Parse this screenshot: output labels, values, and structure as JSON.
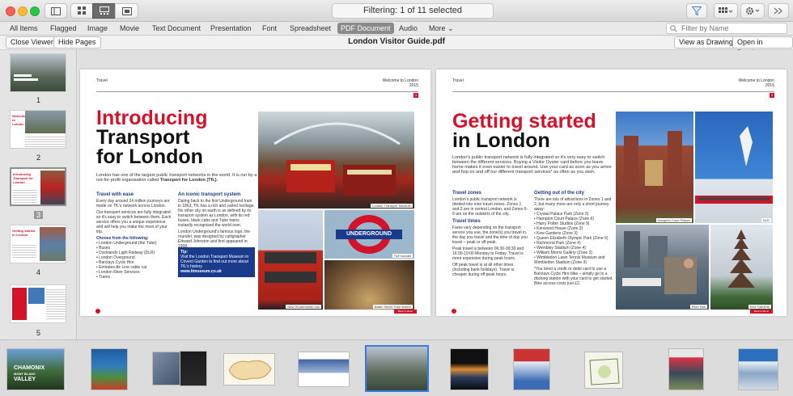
{
  "toolbar": {
    "status": "Filtering: 1 of 11 selected"
  },
  "filters": [
    "All Items",
    "Flagged",
    "Image",
    "Movie",
    "Text Document",
    "Presentation",
    "Font",
    "Spreadsheet",
    "PDF Document",
    "Audio",
    "More"
  ],
  "search": {
    "placeholder": "Filter by Name"
  },
  "viewer": {
    "close_label": "Close Viewer",
    "hide_pages_label": "Hide Pages",
    "title": "London Visitor Guide.pdf",
    "drawing_label": "View as Drawing",
    "preview_label": "Open in Preview"
  },
  "sidebar": {
    "pages": [
      "1",
      "2",
      "3",
      "4",
      "5"
    ],
    "thumb2_title": "Welcome to London",
    "thumb3_title": "Introducing Transport for London",
    "thumb4_title": "Getting started in London"
  },
  "left_page": {
    "section": "Travel",
    "header_right": "Welcome to London",
    "year": "2015",
    "page_no": "3",
    "h_red": "Introducing",
    "h_black1": "Transport",
    "h_black2": "for London",
    "intro1": "London has one of the largest public transport networks in the world.",
    "intro2": "It is run by a not-for-profit organisation called",
    "intro_bold": "Transport for London (TfL).",
    "col1_head": "Travel with ease",
    "col1_p": "Every day around 24 million journeys are made on TfL's network across London.",
    "col1_p2": "Our transport services are fully integrated so it's easy to switch between them. Each service offers you a unique experience and will help you make the most of your trip.",
    "choose": "Choose from the following:",
    "list": [
      "London Underground (the Tube)",
      "Buses",
      "Docklands Light Railway (DLR)",
      "London Overground",
      "Barclays Cycle Hire",
      "Emirates Air Line cable car",
      "London River Services",
      "Trams"
    ],
    "col2_head": "An iconic transport system",
    "col2_p": "Dating back to the first Underground train in 1863, TfL has a rich and varied heritage. No other city on earth is as defined by its transport system as London, with its red buses, black cabs and Tube trains instantly recognised the world over.",
    "col2_p2": "London Underground's famous logo, the roundel, was designed by calligrapher Edward Johnston and first appeared in 1908.",
    "tip_head": "Tip:",
    "tip_body": "Visit the London Transport Museum in Covent Garden to find out more about TfL's history.",
    "tip_url": "www.ltmuseum.co.uk",
    "cap1": "London Transport Museum",
    "cap2": "The roundel",
    "cap3": "New Routemaster bus",
    "cap4": "Baker Street Tube station",
    "underground": "UNDERGROUND",
    "footer": "Back to Menu"
  },
  "right_page": {
    "section": "Travel",
    "header_right": "Welcome to London",
    "year": "2015",
    "page_no": "4",
    "h_red": "Getting started",
    "h_black": "in London",
    "intro": "London's public transport network is fully integrated so it's very easy to switch between the different services. Buying a Visitor Oyster card before you leave home makes it even easier to travel around. Use your card as soon as you arrive and hop on and off our different transport services* as often as you wish.",
    "zones_head": "Travel zones",
    "zones_p": "London's public transport network is divided into nine travel zones. Zones 1 and 2 are in central London, and Zones 6-9 are on the outskirts of the city.",
    "times_head": "Travel times",
    "times_p": "Fares vary depending on the transport service you use, the zone(s) you travel in, the day you travel and the time of day you travel – peak or off peak.",
    "times_p2": "Peak travel is between 06:30-09:30 and 16:00-19:00 Monday to Friday. Travel is more expensive during peak hours.",
    "times_p3": "Off peak travel is at all other times (including bank holidays). Travel is cheaper during off peak hours.",
    "out_head": "Getting out of the city",
    "out_p": "There are lots of attractions in Zones 1 and 2, but many more are only a short journey away:",
    "list": [
      "Crystal Palace Park (Zone 3)",
      "Hampton Court Palace (Zone 6)",
      "Harry Potter Studios (Zone 9)",
      "Kenwood House (Zone 3)",
      "Kew Gardens (Zone 3)",
      "Queen Elizabeth Olympic Park (Zone 5)",
      "Richmond Park (Zone 4)",
      "Wembley Stadium (Zone 4)",
      "William Morris Gallery (Zone 3)",
      "Wimbledon Lawn Tennis Museum and Wimbledon Stadium (Zone 3)"
    ],
    "note": "*You need a credit or debit card to use a Barclays Cycle Hire bike – simply go to a docking station with your card to get started. Bike access costs just £2.",
    "cap1": "Hampton Court Palace",
    "cap2": "DLR",
    "cap3": "River Bus",
    "cap4": "Kew Gardens",
    "footer": "Back to Menu"
  },
  "strip": {
    "chamonix": "CHAMONIX",
    "mont_blanc": "MONT BLANC",
    "valley": "VALLEY"
  },
  "colors": {
    "accent": "#d4122a",
    "selection": "#3b7ae3",
    "tfl_blue": "#1a3b8c"
  }
}
